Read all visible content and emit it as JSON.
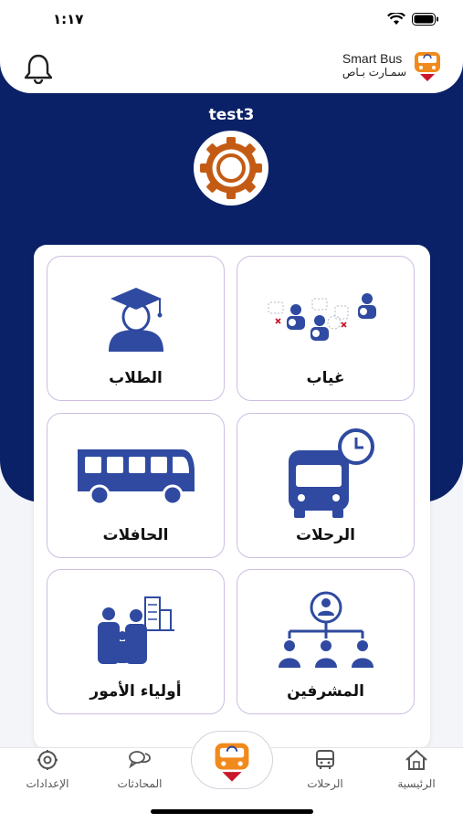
{
  "status_bar": {
    "time": "١:١٧"
  },
  "header": {
    "brand_en": "Smart Bus",
    "brand_ar": "سمـارت بـاص"
  },
  "school": {
    "name": "test3"
  },
  "tiles": [
    {
      "label": "غياب",
      "icon": "absence-icon"
    },
    {
      "label": "الطلاب",
      "icon": "student-graduate-icon"
    },
    {
      "label": "الرحلات",
      "icon": "bus-clock-icon"
    },
    {
      "label": "الحافلات",
      "icon": "bus-icon"
    },
    {
      "label": "المشرفين",
      "icon": "supervisors-hierarchy-icon"
    },
    {
      "label": "أولياء الأمور",
      "icon": "parents-icon"
    }
  ],
  "bottom_nav": [
    {
      "label": "الرئيسية",
      "icon": "home-icon"
    },
    {
      "label": "الرحلات",
      "icon": "bus-icon"
    },
    {
      "label": "المحادثات",
      "icon": "chat-icon"
    },
    {
      "label": "الإعدادات",
      "icon": "gear-icon"
    }
  ],
  "colors": {
    "navy": "#0b2167",
    "accent_orange": "#c45b14",
    "tile_border": "#cdbde3",
    "icon_blue": "#2f4aa0"
  }
}
